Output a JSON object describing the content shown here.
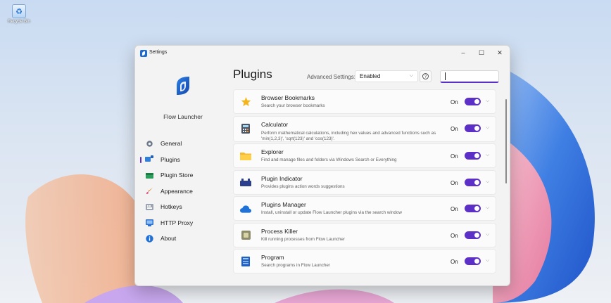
{
  "desktop": {
    "recycle_bin_label": "Recycle Bin"
  },
  "window": {
    "title": "Settings",
    "controls": {
      "minimize": "–",
      "maximize": "☐",
      "close": "✕"
    }
  },
  "sidebar": {
    "app_name": "Flow Launcher",
    "items": [
      {
        "label": "General",
        "icon": "gear-icon",
        "active": false
      },
      {
        "label": "Plugins",
        "icon": "plugins-icon",
        "active": true
      },
      {
        "label": "Plugin Store",
        "icon": "store-icon",
        "active": false
      },
      {
        "label": "Appearance",
        "icon": "brush-icon",
        "active": false
      },
      {
        "label": "Hotkeys",
        "icon": "keyboard-icon",
        "active": false
      },
      {
        "label": "HTTP Proxy",
        "icon": "proxy-icon",
        "active": false
      },
      {
        "label": "About",
        "icon": "info-icon",
        "active": false
      }
    ]
  },
  "content": {
    "page_title": "Plugins",
    "advanced_settings_label": "Advanced Settings:",
    "advanced_settings_value": "Enabled",
    "help_glyph": "?",
    "search_value": "",
    "plugins": [
      {
        "name": "Browser Bookmarks",
        "description": "Search your browser bookmarks",
        "state": "On",
        "enabled": true,
        "icon": "star-icon"
      },
      {
        "name": "Calculator",
        "description": "Perform mathematical calculations, including hex values and advanced functions such as 'min(1,2,3)', 'sqrt(123)' and 'cos(123)'.",
        "state": "On",
        "enabled": true,
        "icon": "calculator-icon"
      },
      {
        "name": "Explorer",
        "description": "Find and manage files and folders via Windows Search or Everything",
        "state": "On",
        "enabled": true,
        "icon": "folder-icon"
      },
      {
        "name": "Plugin Indicator",
        "description": "Provides plugins action words suggestions",
        "state": "On",
        "enabled": true,
        "icon": "indicator-icon"
      },
      {
        "name": "Plugins Manager",
        "description": "Install, uninstall or update Flow Launcher plugins via the search window",
        "state": "On",
        "enabled": true,
        "icon": "cloud-icon"
      },
      {
        "name": "Process Killer",
        "description": "Kill running processes from Flow Launcher",
        "state": "On",
        "enabled": true,
        "icon": "process-icon"
      },
      {
        "name": "Program",
        "description": "Search programs in Flow Launcher",
        "state": "On",
        "enabled": true,
        "icon": "program-icon"
      }
    ]
  },
  "colors": {
    "accent": "#5c2fc7"
  }
}
